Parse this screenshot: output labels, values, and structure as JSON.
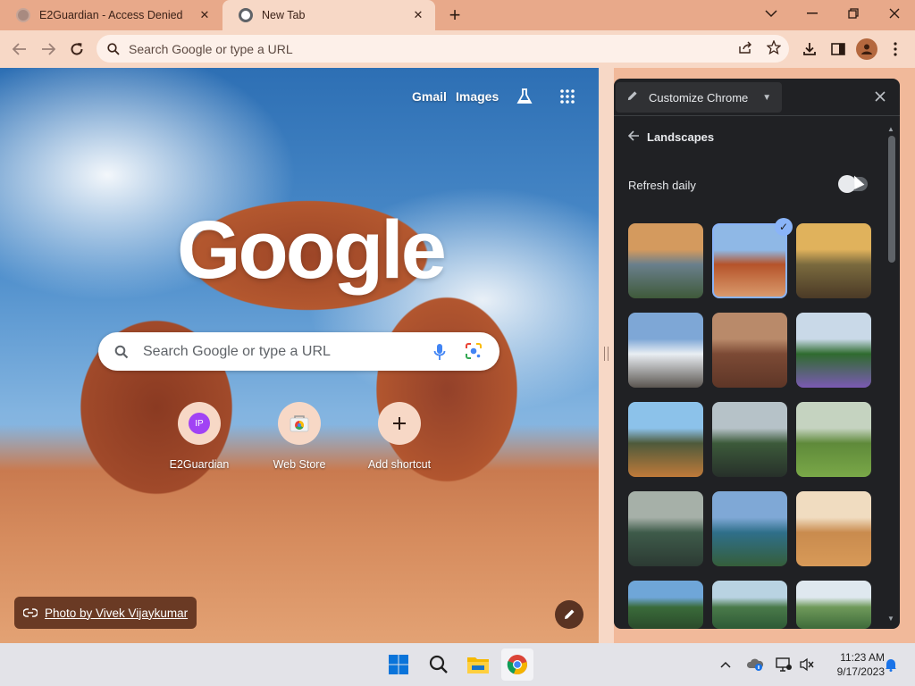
{
  "tabs": [
    {
      "title": "E2Guardian - Access Denied",
      "active": false
    },
    {
      "title": "New Tab",
      "active": true
    }
  ],
  "window_controls": {
    "list_tabs": "chevron-down-icon",
    "minimize": "minimize-icon",
    "restore": "restore-icon",
    "close": "close-icon"
  },
  "toolbar": {
    "omnibox_placeholder": "Search Google or type a URL"
  },
  "ntp": {
    "gmail": "Gmail",
    "images": "Images",
    "logo": "Google",
    "search_placeholder": "Search Google or type a URL",
    "shortcuts": [
      {
        "label": "E2Guardian",
        "initials": "IP",
        "color": "#a142f4"
      },
      {
        "label": "Web Store"
      },
      {
        "label": "Add shortcut"
      }
    ],
    "credit": "Photo by Vivek Vijaykumar"
  },
  "panel": {
    "title": "Customize Chrome",
    "collection": "Landscapes",
    "refresh_label": "Refresh daily",
    "refresh_on": false,
    "selected_index": 1,
    "thumbnails": [
      {
        "colors": [
          "#d49a5e",
          "#6a7f8c",
          "#3f5a3a"
        ]
      },
      {
        "colors": [
          "#8fb8e6",
          "#b5532a",
          "#d99a6c"
        ]
      },
      {
        "colors": [
          "#e0b25c",
          "#7a6a3e",
          "#4b3a26"
        ]
      },
      {
        "colors": [
          "#7ea7d6",
          "#e9eef3",
          "#5a5550"
        ]
      },
      {
        "colors": [
          "#b98a6a",
          "#7c4a35",
          "#5e3627"
        ]
      },
      {
        "colors": [
          "#c9d9e8",
          "#2f6b2f",
          "#7b5ab3"
        ]
      },
      {
        "colors": [
          "#8cc2ea",
          "#4e5a3b",
          "#c07a3a"
        ]
      },
      {
        "colors": [
          "#b6c2c8",
          "#3c5a3a",
          "#27302a"
        ]
      },
      {
        "colors": [
          "#c5d3c0",
          "#5f8a3a",
          "#7aa848"
        ]
      },
      {
        "colors": [
          "#a6b0a8",
          "#3e5b4a",
          "#2c3a33"
        ]
      },
      {
        "colors": [
          "#7fa8d6",
          "#2f6f8a",
          "#355e3a"
        ]
      },
      {
        "colors": [
          "#f0dcc0",
          "#c98b4e",
          "#d89a58"
        ]
      },
      {
        "colors": [
          "#6fa6d8",
          "#3a6b3a",
          "#2a4a2a"
        ]
      },
      {
        "colors": [
          "#b9d3e2",
          "#4a7a4a",
          "#2e5a35"
        ]
      },
      {
        "colors": [
          "#dfe8ef",
          "#6f9a5a",
          "#3e6a3a"
        ]
      }
    ]
  },
  "taskbar": {
    "time": "11:23 AM",
    "date": "9/17/2023"
  }
}
